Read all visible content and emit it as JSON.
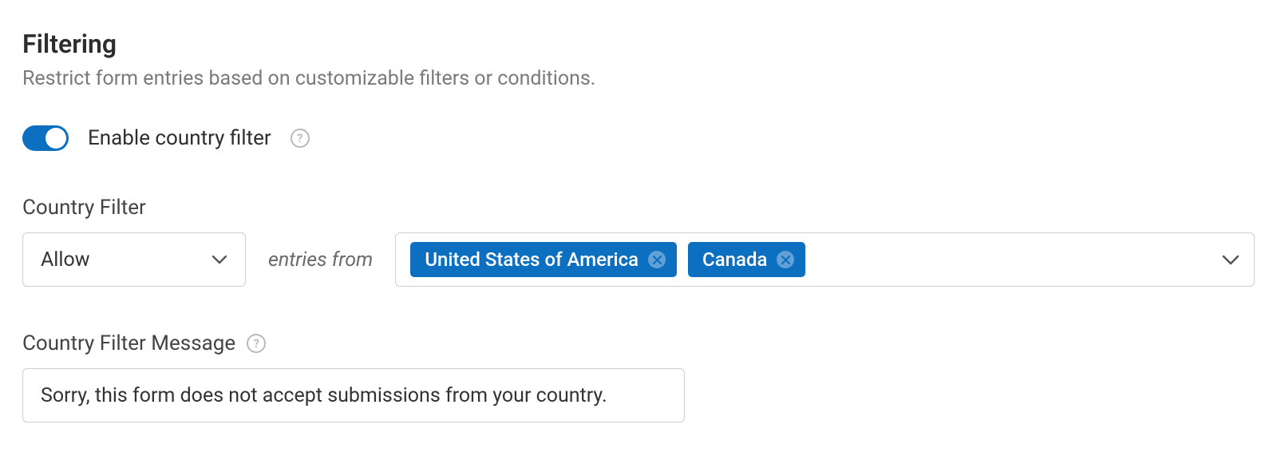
{
  "section": {
    "title": "Filtering",
    "description": "Restrict form entries based on customizable filters or conditions."
  },
  "toggle": {
    "label": "Enable country filter",
    "enabled": true
  },
  "countryFilter": {
    "label": "Country Filter",
    "modeValue": "Allow",
    "joiner": "entries from",
    "tags": [
      {
        "label": "United States of America"
      },
      {
        "label": "Canada"
      }
    ]
  },
  "message": {
    "label": "Country Filter Message",
    "value": "Sorry, this form does not accept submissions from your country."
  }
}
